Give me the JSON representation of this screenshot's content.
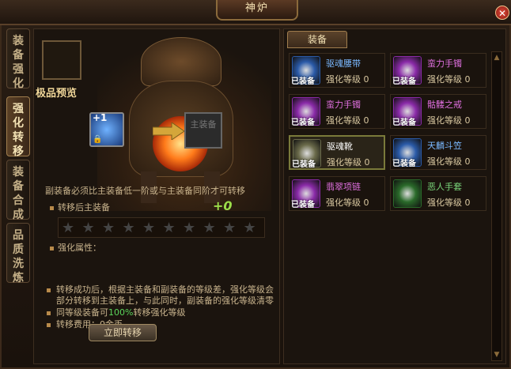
{
  "window": {
    "title": "神炉",
    "close_icon": "close-icon"
  },
  "sidebar": {
    "tabs": [
      {
        "label": "装备强化",
        "active": false
      },
      {
        "label": "强化转移",
        "active": true
      },
      {
        "label": "装备合成",
        "active": false
      },
      {
        "label": "品质洗炼",
        "active": false
      }
    ]
  },
  "transfer": {
    "preview_label": "极品预览",
    "source_plus": "+1",
    "target_slot_label": "主装备",
    "requirement": "副装备必须比主装备低一阶或与主装备同阶才可转移",
    "after_label": "转移后主装备",
    "after_value": "+0",
    "star_count": 10,
    "stars_filled": 0,
    "attr_label": "强化属性：",
    "notes": [
      "转移成功后，根据主装备和副装备的等级差，强化等级会部分转移到主装备上，与此同时，副装备的强化等级清零",
      "同等级装备可100%转移强化等级",
      "转移费用：0金币"
    ],
    "note2_parts": {
      "pre": "同等级装备可",
      "highlight": "100%",
      "post": "转移强化等级"
    },
    "button_label": "立即转移"
  },
  "equipment": {
    "tab_label": "装备",
    "equipped_text": "已装备",
    "level_prefix": "强化等级",
    "items": [
      {
        "name": "驱魂腰带",
        "level": "0",
        "name_color": "#7ab8ff",
        "icon_color": "#2a5aa8",
        "equipped": true
      },
      {
        "name": "蛮力手镯",
        "level": "0",
        "name_color": "#e070e0",
        "icon_color": "#8a2aa8",
        "equipped": true
      },
      {
        "name": "蛮力手镯",
        "level": "0",
        "name_color": "#e070e0",
        "icon_color": "#8a2aa8",
        "equipped": true
      },
      {
        "name": "骷髅之戒",
        "level": "0",
        "name_color": "#e070e0",
        "icon_color": "#8a2aa8",
        "equipped": true
      },
      {
        "name": "驱魂靴",
        "level": "0",
        "name_color": "#ffffff",
        "icon_color": "#6a6a4a",
        "equipped": true,
        "selected": true
      },
      {
        "name": "天麟斗笠",
        "level": "0",
        "name_color": "#7ab8ff",
        "icon_color": "#2a5aa8",
        "equipped": true
      },
      {
        "name": "翡翠项链",
        "level": "0",
        "name_color": "#e070e0",
        "icon_color": "#8a2aa8",
        "equipped": true
      },
      {
        "name": "恶人手套",
        "level": "0",
        "name_color": "#7ad67a",
        "icon_color": "#2a6a2a",
        "equipped": false
      }
    ]
  }
}
